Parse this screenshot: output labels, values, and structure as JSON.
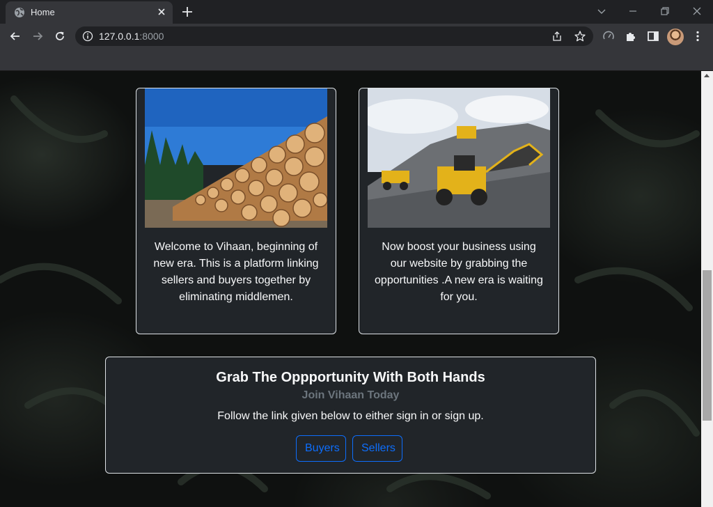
{
  "browser": {
    "tab": {
      "title": "Home"
    },
    "url": {
      "host": "127.0.0.1",
      "port": ":8000"
    }
  },
  "cards": [
    {
      "text": "Welcome to Vihaan, beginning of new era. This is a platform linking sellers and buyers together by eliminating middlemen."
    },
    {
      "text": "Now boost your business using our website by grabbing the opportunities .A new era is waiting for you."
    }
  ],
  "cta": {
    "title": "Grab The Oppportunity With Both Hands",
    "subtitle": "Join Vihaan Today",
    "text": "Follow the link given below to either sign in or sign up.",
    "buttons": {
      "buyers": "Buyers",
      "sellers": "Sellers"
    },
    "accent": "#0d6efd"
  },
  "icons": [
    "globe-icon",
    "close-icon",
    "plus-icon",
    "chevron-down-icon",
    "minimize-icon",
    "restore-icon",
    "window-close-icon",
    "back-icon",
    "forward-icon",
    "reload-icon",
    "info-icon",
    "share-icon",
    "star-icon",
    "performance-icon",
    "extensions-icon",
    "side-panel-icon",
    "menu-icon"
  ]
}
